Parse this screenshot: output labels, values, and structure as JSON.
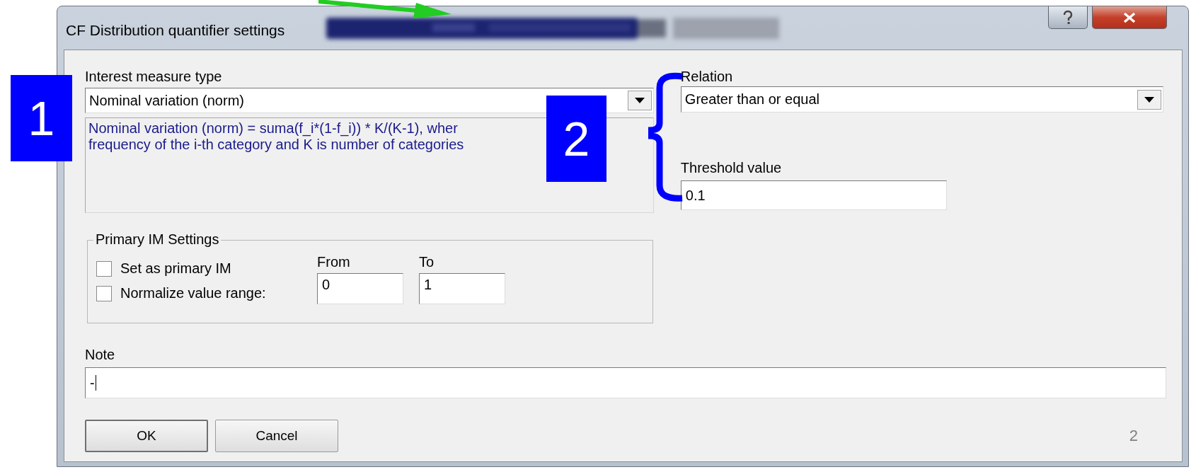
{
  "window": {
    "title": "CF Distribution quantifier settings"
  },
  "interest_measure": {
    "label": "Interest measure type",
    "value": "Nominal variation (norm)",
    "description": [
      "Nominal variation (norm) = suma(f_i*(1-f_i)) * K/(K-1), wher",
      "frequency of the i-th category and K is number of categories"
    ]
  },
  "relation": {
    "label": "Relation",
    "value": "Greater than or equal"
  },
  "threshold": {
    "label": "Threshold value",
    "value": "0.1"
  },
  "primary_im": {
    "title": "Primary IM Settings",
    "checkboxes": [
      {
        "label": "Set as primary IM",
        "checked": false
      },
      {
        "label": "Normalize value range:",
        "checked": false
      }
    ],
    "from": {
      "label": "From",
      "value": "0"
    },
    "to": {
      "label": "To",
      "value": "1"
    }
  },
  "note": {
    "label": "Note",
    "value": "-"
  },
  "buttons": [
    "OK",
    "Cancel"
  ],
  "counter": "2",
  "callouts": [
    {
      "label": "1"
    },
    {
      "label": "2"
    }
  ]
}
